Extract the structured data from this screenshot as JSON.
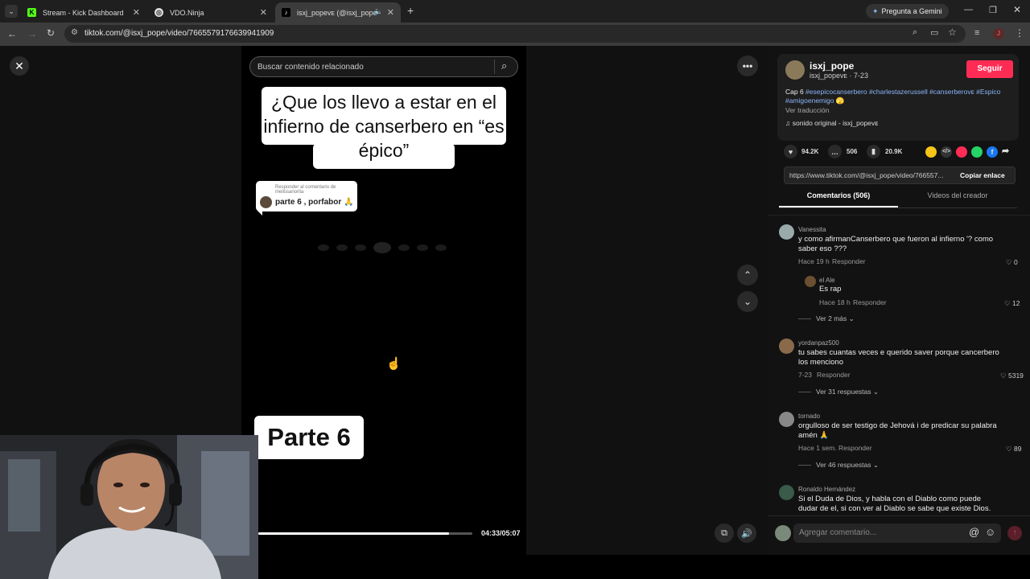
{
  "browser": {
    "tabs": [
      {
        "title": "Stream - Kick Dashboard",
        "fav": "K"
      },
      {
        "title": "VDO.Ninja",
        "fav": "◎"
      },
      {
        "title": "isxj_popeᴠᴇ (@isxj_pope) | T",
        "fav": "♪"
      }
    ],
    "new_tab": "+",
    "gemini": "Pregunta a Gemini",
    "url": "tiktok.com/@isxj_pope/video/7665579176639941909",
    "profile_initial": "J"
  },
  "video": {
    "search_placeholder": "Buscar contenido relacionado",
    "caption_top": "¿Que los llevo a estar en el infierno de canserbero en “es épico”",
    "reply_header": "Responder al comentario de melissanorita",
    "reply_text": "parte 6 , porfabor 🙏",
    "caption_bottom": "Parte 6",
    "time": "04:33/05:07",
    "progress": 0.89
  },
  "author": {
    "name": "isxj_pope",
    "handle_date": "isxj_popeᴠᴇ · 7-23",
    "follow": "Seguir",
    "desc_prefix": "Cap 6 ",
    "hashtags": "#esepicocanserbero #charlestazerussell #canserberoᴠᴇ #Espico #amigoenemigo 🫣",
    "translate": "Ver traducción",
    "sound": "sonido original - isxj_popeᴠᴇ"
  },
  "stats": {
    "likes": "94.2K",
    "comments": "506",
    "saves": "20.9K"
  },
  "share": {
    "link": "https://www.tiktok.com/@isxj_pope/video/766557...",
    "copy": "Copiar enlace"
  },
  "tabs": {
    "comments": "Comentarios (506)",
    "videos": "Videos del creador"
  },
  "comments": [
    {
      "user": "Vanessita",
      "text": "y como afirmanCanserbero que fueron al infierno '? como saber eso ???",
      "time": "Hace 19 h",
      "reply": "Responder",
      "likes": "0"
    },
    {
      "user": "el Ale",
      "text": "Es rap",
      "time": "Hace 18 h",
      "reply": "Responder",
      "likes": "12"
    },
    {
      "more": "Ver 2 más"
    },
    {
      "user": "yordanpaz500",
      "text": "tu sabes cuantas veces e querido saver porque cancerbero los menciono",
      "time": "7-23",
      "reply": "Responder",
      "likes": "5319"
    },
    {
      "more": "Ver 31 respuestas"
    },
    {
      "user": "tornado",
      "text": "orgulloso de ser testigo de Jehová i de predicar su palabra amén 🙏",
      "time": "Hace 1 sem.",
      "reply": "Responder",
      "likes": "89"
    },
    {
      "more": "Ver 46 respuestas"
    },
    {
      "user": "Ronaldo Hernández",
      "text": "Si el Duda de Dios, y habla con el Diablo como puede dudar de el, si con ver al Diablo se sabe que existe Dios."
    }
  ],
  "composer": {
    "placeholder": "Agregar comentario..."
  },
  "icons": {
    "close": "close-icon",
    "search": "search-icon",
    "more": "more-icon"
  }
}
